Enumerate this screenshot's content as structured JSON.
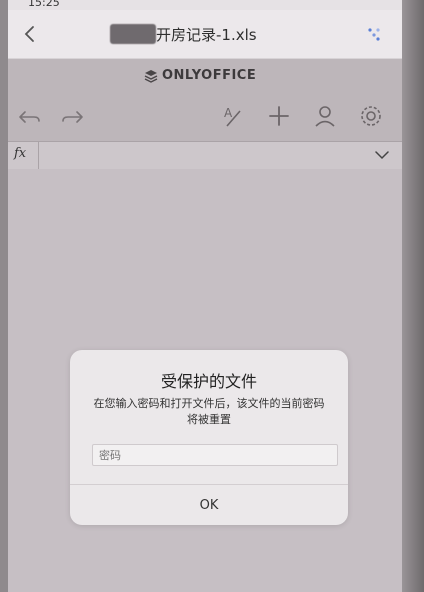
{
  "status_bar": {
    "time": "15:25"
  },
  "title_bar": {
    "file_name": "开房记录-1.xls"
  },
  "brand": {
    "name": "ONLYOFFICE"
  },
  "formula_bar": {
    "fx_label": "fx"
  },
  "dialog": {
    "title": "受保护的文件",
    "message": "在您输入密码和打开文件后，该文件的当前密码将被重置",
    "password_placeholder": "密码",
    "ok_label": "OK"
  },
  "icons": {
    "back": "chevron-left-icon",
    "menu": "menu-icon",
    "logo": "onlyoffice-logo-icon",
    "undo": "undo-icon",
    "redo": "redo-icon",
    "edit": "edit-text-icon",
    "add": "plus-icon",
    "user": "user-icon",
    "settings": "gear-icon",
    "formula_expand": "chevron-down-icon"
  }
}
